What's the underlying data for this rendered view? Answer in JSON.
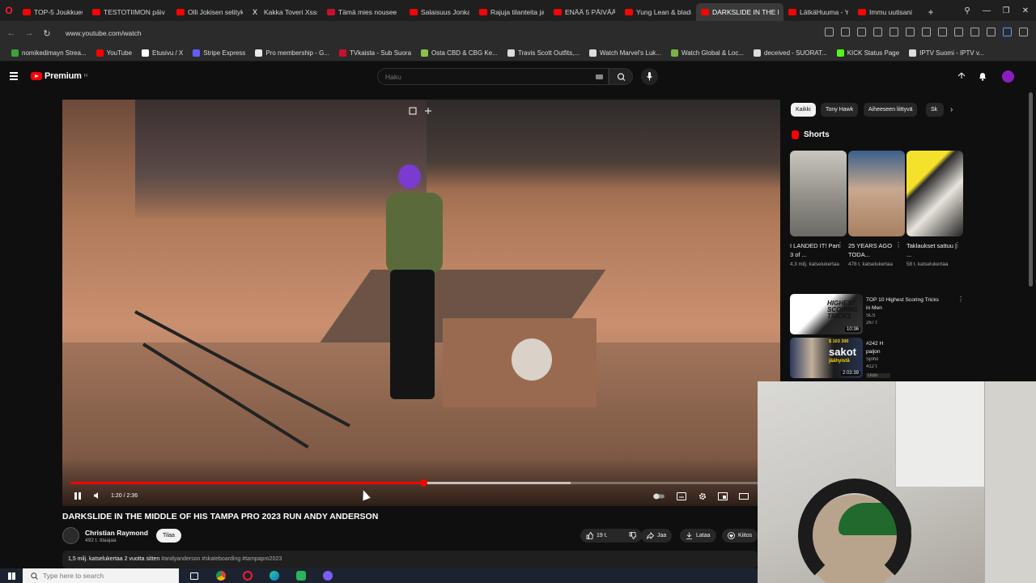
{
  "browser": {
    "tabs": [
      {
        "label": "TOP-5 Joukkueuuso",
        "favicon": "youtube-icon"
      },
      {
        "label": "TESTOTIIMON päiv",
        "favicon": "youtube-icon"
      },
      {
        "label": "Olli Jokisen selityk",
        "favicon": "youtube-icon"
      },
      {
        "label": "Kakka Toveri Xsssi",
        "favicon": "x-icon"
      },
      {
        "label": "Tämä mies nousee",
        "favicon": "wp-icon"
      },
      {
        "label": "Salaisuus Jonka Vie",
        "favicon": "youtube-icon"
      },
      {
        "label": "Rajuja tilanteita ja p",
        "favicon": "youtube-icon"
      },
      {
        "label": "ENÄÄ 5 PÄIVÄÄ ▲",
        "favicon": "youtube-icon"
      },
      {
        "label": "Yung Lean & blade",
        "favicon": "youtube-icon"
      },
      {
        "label": "DARKSLIDE IN THE MI",
        "favicon": "youtube-icon",
        "active": true
      },
      {
        "label": "LätkäHuuma - You",
        "favicon": "youtube-icon"
      },
      {
        "label": "Immu uutisani",
        "favicon": "youtube-icon"
      }
    ],
    "url": "www.youtube.com/watch",
    "bookmarks": [
      "nomikedimayn Strea...",
      "YouTube",
      "Etusivu / X",
      "Stripe Express",
      "Pro membership - G...",
      "TVkaista - Sub Suora",
      "Osta CBD & CBG Ke...",
      "Travis Scott Outfits,...",
      "Watch Marvel's Luk...",
      "Watch Global & Loc...",
      "deceived - SUORAT...",
      "KICK Status Page",
      "IPTV Suomi - IPTV v..."
    ]
  },
  "youtube": {
    "logo_text": "Premium",
    "logo_sup": "FI",
    "search_placeholder": "Haku",
    "video": {
      "time": "1:20 / 2:36",
      "played_fraction": 0.513,
      "loaded_fraction": 0.727,
      "title": "DARKSLIDE IN THE MIDDLE OF HIS TAMPA PRO 2023 RUN ANDY ANDERSON"
    },
    "channel": {
      "name": "Christian Raymond",
      "subs": "492 t. tilaajaa",
      "subscribe_label": "Tilaa"
    },
    "actions": {
      "likes": "19 t.",
      "share": "Jaa",
      "download": "Lataa",
      "thanks": "Kiitos"
    },
    "description": {
      "stats": "1,5 milj. katselukertaa  2 vuotta sitten",
      "tags": "#andyanderson #skateboarding #tampapro2023"
    },
    "chips": [
      "Kaikki",
      "Tony Hawk",
      "Aiheeseen liittyvä",
      "Sk"
    ],
    "shorts_title": "Shorts",
    "shorts": [
      {
        "title": "I LANDED IT! Part 3 of ...",
        "views": "4,3 milj. katselukertaa"
      },
      {
        "title": "25 YEARS AGO TODA...",
        "views": "478 t. katselukertaa"
      },
      {
        "title": "Taklaukset sattuu | ...",
        "views": "58 t. katselukertaa"
      }
    ],
    "recommended": [
      {
        "title": "TOP 10 Highest Scoring Tricks",
        "line2": "in Men",
        "meta": "SLS",
        "meta2": "267 t",
        "duration": "10:36",
        "thumb_text": "HIGHEST SCORING TRICKS"
      },
      {
        "title": "#242 H",
        "line2": "paljon",
        "meta": "Sjoho",
        "meta2": "412 t",
        "duration": "2:03:39",
        "thumb_text": "sakot",
        "thumb_line1": "$ 103 300",
        "thumb_line3": "jäähyistä",
        "badge": "Uusi"
      }
    ]
  },
  "taskbar": {
    "search_placeholder": "Type here to search"
  },
  "colors": {
    "youtube_red": "#ff0000",
    "background": "#0f0f0f",
    "chip_bg": "#272727"
  }
}
